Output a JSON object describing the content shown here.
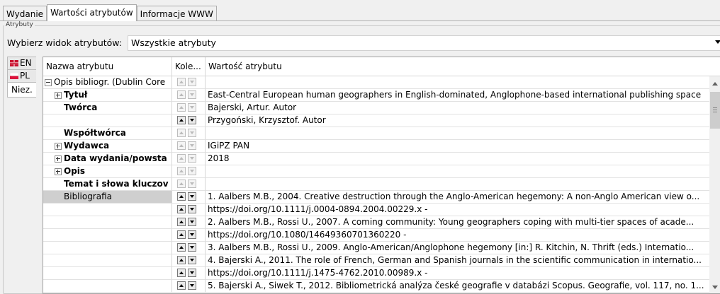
{
  "tabs": [
    "Wydanie",
    "Wartości atrybutów",
    "Informacje WWW"
  ],
  "group_title": "Atrybuty",
  "view": {
    "label": "Wybierz widok atrybutów:",
    "selected": "Wszystkie atrybuty"
  },
  "languages": [
    "EN",
    "PL",
    "Niez."
  ],
  "columns": {
    "name": "Nazwa atrybutu",
    "order": "Kole...",
    "value": "Wartość atrybutu"
  },
  "rows": [
    {
      "name": "Opis bibliogr. (Dublin Core",
      "value": ""
    },
    {
      "name": "Tytuł",
      "value": "East-Central European human geographers in English-dominated, Anglophone-based international publishing space"
    },
    {
      "name": "Twórca",
      "value": "Bajerski, Artur. Autor"
    },
    {
      "name": "",
      "value": "Przygoński, Krzysztof. Autor"
    },
    {
      "name": "Współtwórca",
      "value": ""
    },
    {
      "name": "Wydawca",
      "value": "IGiPZ PAN"
    },
    {
      "name": "Data wydania/powsta",
      "value": "2018"
    },
    {
      "name": "Opis",
      "value": ""
    },
    {
      "name": "Temat i słowa kluczov",
      "value": ""
    },
    {
      "name": "Bibliografia",
      "value": "1. Aalbers M.B., 2004. Creative destruction through the Anglo-American hegemony: A non-Anglo American view o..."
    },
    {
      "name": "",
      "value": "https://doi.org/10.1111/j.0004-0894.2004.00229.x -"
    },
    {
      "name": "",
      "value": "2. Aalbers M.B., Rossi U., 2007. A coming community: Young geographers coping with multi-tier spaces of acade..."
    },
    {
      "name": "",
      "value": "https://doi.org/10.1080/14649360701360220 -"
    },
    {
      "name": "",
      "value": "3. Aalbers M.B., Rossi U., 2009. Anglo-American/Anglophone hegemony [in:] R. Kitchin, N. Thrift (eds.) Internatio..."
    },
    {
      "name": "",
      "value": "4. Bajerski A., 2011. The role of French, German and Spanish journals in the scientific communication in internatio..."
    },
    {
      "name": "",
      "value": "https://doi.org/10.1111/j.1475-4762.2010.00989.x -"
    },
    {
      "name": "",
      "value": "5. Bajerski A., Siwek T., 2012. Bibliometrická analýza české geografie v databázi Scopus. Geografie, vol. 117, no. 1..."
    }
  ]
}
